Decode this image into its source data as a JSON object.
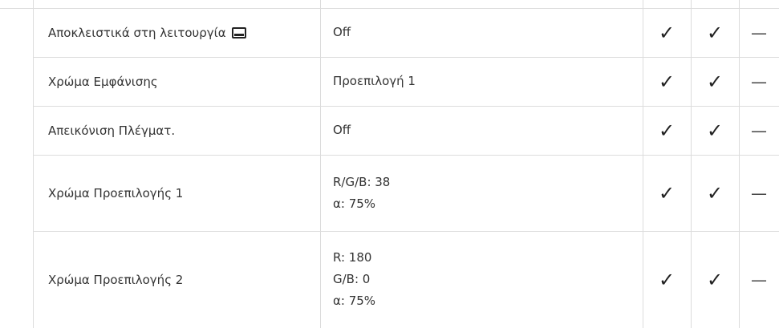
{
  "table": {
    "rows": [
      {
        "setting": "Αποκλειστικά στη λειτουργία",
        "setting_icon": "monitor-icon",
        "value_lines": [
          "Off"
        ],
        "check1": "✓",
        "check2": "✓",
        "dash": "—"
      },
      {
        "setting": "Χρώμα Εμφάνισης",
        "value_lines": [
          "Προεπιλογή 1"
        ],
        "check1": "✓",
        "check2": "✓",
        "dash": "—"
      },
      {
        "setting": "Απεικόνιση Πλέγματ.",
        "value_lines": [
          "Off"
        ],
        "check1": "✓",
        "check2": "✓",
        "dash": "—"
      },
      {
        "setting": "Χρώμα Προεπιλογής 1",
        "value_lines": [
          "R/G/B: 38",
          "α: 75%"
        ],
        "check1": "✓",
        "check2": "✓",
        "dash": "—"
      },
      {
        "setting": "Χρώμα Προεπιλογής 2",
        "value_lines": [
          "R: 180",
          "G/B: 0",
          "α: 75%"
        ],
        "check1": "✓",
        "check2": "✓",
        "dash": "—"
      }
    ]
  }
}
